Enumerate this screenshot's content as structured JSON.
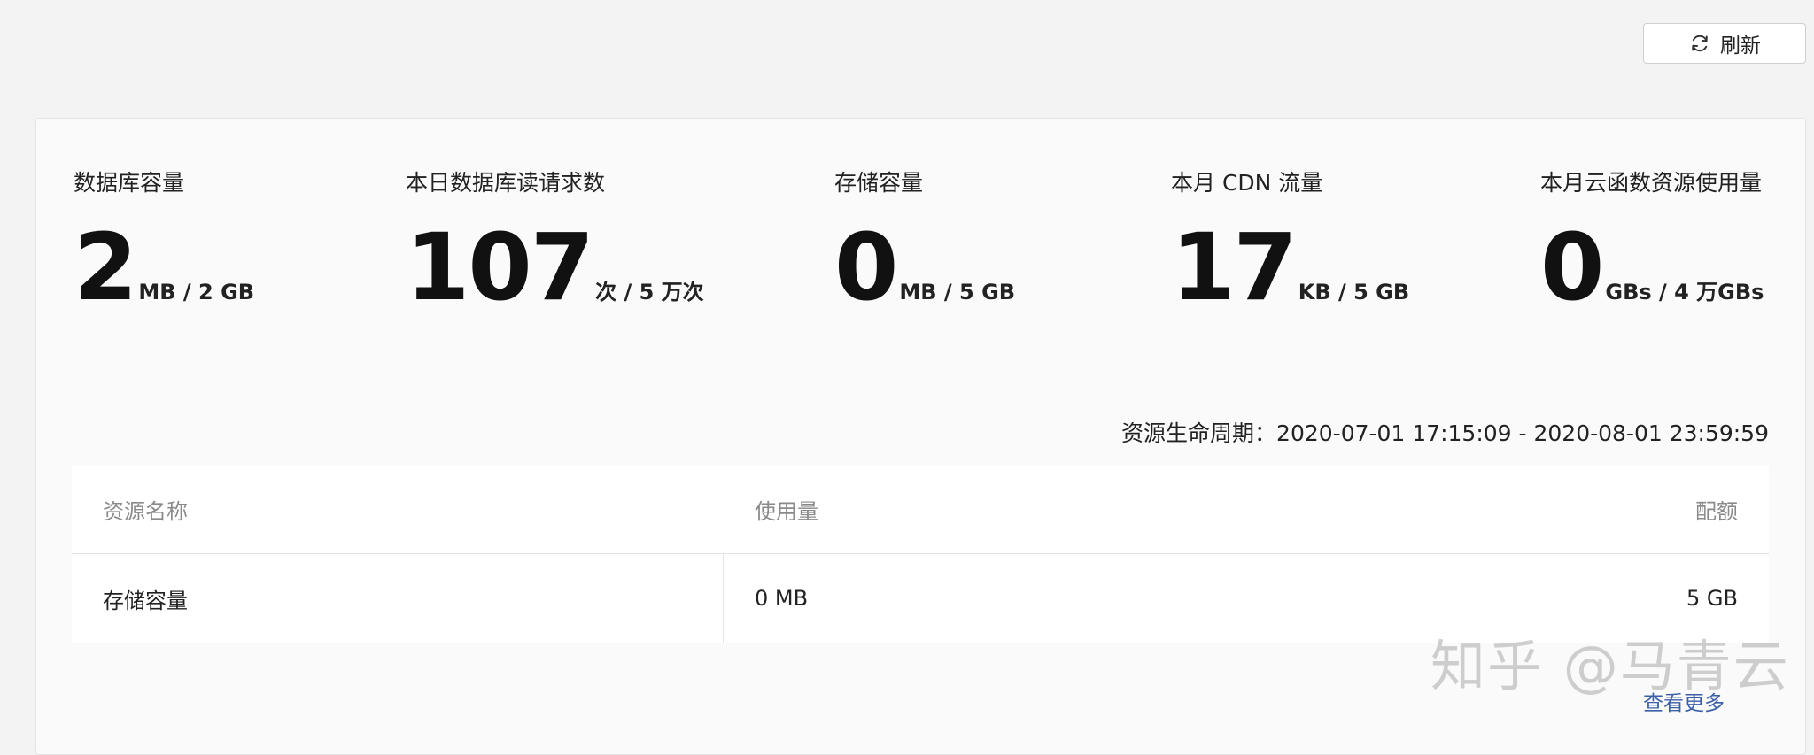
{
  "toolbar": {
    "refresh_label": "刷新",
    "refresh_icon": "refresh-icon"
  },
  "stats": [
    {
      "title": "数据库容量",
      "value": "2",
      "unit": "MB / 2 GB"
    },
    {
      "title": "本日数据库读请求数",
      "value": "107",
      "unit": "次 / 5 万次"
    },
    {
      "title": "存储容量",
      "value": "0",
      "unit": "MB / 5 GB"
    },
    {
      "title": "本月 CDN 流量",
      "value": "17",
      "unit": "KB / 5 GB"
    },
    {
      "title": "本月云函数资源使用量",
      "value": "0",
      "unit": "GBs / 4 万GBs"
    }
  ],
  "lifecycle": {
    "text": "资源生命周期：2020-07-01 17:15:09 - 2020-08-01 23:59:59"
  },
  "table": {
    "headers": [
      "资源名称",
      "使用量",
      "配额"
    ],
    "rows": [
      [
        "存储容量",
        "0 MB",
        "5 GB"
      ]
    ]
  },
  "watermark": {
    "text": "知乎 @马青云"
  },
  "more_link": {
    "label": "查看更多"
  },
  "colors": {
    "background": "#f3f3f3",
    "panel": "#fafafa",
    "link": "#3b5fa6",
    "muted_text": "#8a8a8a"
  }
}
